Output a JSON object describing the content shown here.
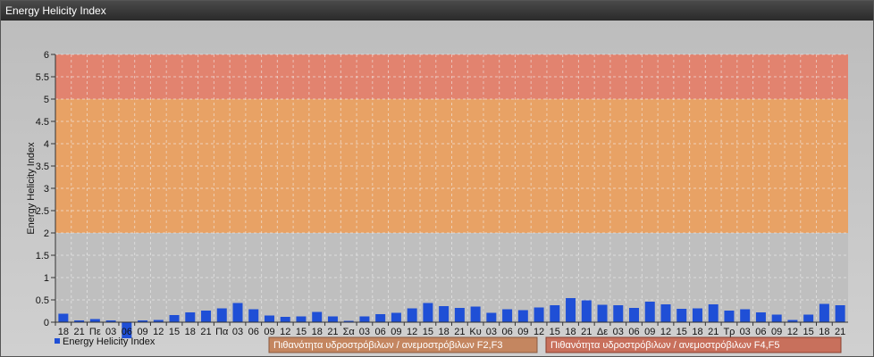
{
  "window": {
    "title": "Energy Helicity Index"
  },
  "colors": {
    "bar": "#1f4fd6",
    "band_high": "#e2836f",
    "band_mid": "#e8a265",
    "band_low": "#bfbfbf",
    "legend_f2f3": "#c48660",
    "legend_f4f5": "#c8705c"
  },
  "chart_data": {
    "type": "bar",
    "title": "",
    "ylabel": "Energy Helicity Index",
    "xlabel": "",
    "ylim": [
      0,
      6
    ],
    "yticks": [
      "0",
      "0.5",
      "1",
      "1.5",
      "2",
      "2.5",
      "3",
      "3.5",
      "4",
      "4.5",
      "5",
      "5.5",
      "6"
    ],
    "grid": true,
    "legend_position": "bottom",
    "categories": [
      "18",
      "21",
      "Πε",
      "03",
      "06",
      "09",
      "12",
      "15",
      "18",
      "21",
      "Πα",
      "03",
      "06",
      "09",
      "12",
      "15",
      "18",
      "21",
      "Σα",
      "03",
      "06",
      "09",
      "12",
      "15",
      "18",
      "21",
      "Κυ",
      "03",
      "06",
      "09",
      "12",
      "15",
      "18",
      "21",
      "Δε",
      "03",
      "06",
      "09",
      "12",
      "15",
      "18",
      "21",
      "Τρ",
      "03",
      "06",
      "09",
      "12",
      "15",
      "18",
      "21"
    ],
    "series": [
      {
        "name": "Energy Helicity Index",
        "values": [
          0.19,
          0.04,
          0.07,
          0.04,
          -0.36,
          0.04,
          0.05,
          0.16,
          0.22,
          0.26,
          0.31,
          0.43,
          0.29,
          0.15,
          0.12,
          0.13,
          0.23,
          0.13,
          0.03,
          0.13,
          0.18,
          0.21,
          0.31,
          0.43,
          0.36,
          0.32,
          0.35,
          0.21,
          0.29,
          0.27,
          0.33,
          0.38,
          0.54,
          0.49,
          0.39,
          0.38,
          0.32,
          0.46,
          0.4,
          0.3,
          0.31,
          0.4,
          0.26,
          0.29,
          0.22,
          0.17,
          0.05,
          0.17,
          0.41,
          0.38
        ]
      }
    ],
    "bands": [
      {
        "from": 5,
        "to": 6,
        "label": "Πιθανότητα υδροστρόβιλων / ανεμοστρόβιλων F4,F5"
      },
      {
        "from": 2,
        "to": 5,
        "label": "Πιθανότητα υδροστρόβιλων / ανεμοστρόβιλων F2,F3"
      }
    ]
  }
}
